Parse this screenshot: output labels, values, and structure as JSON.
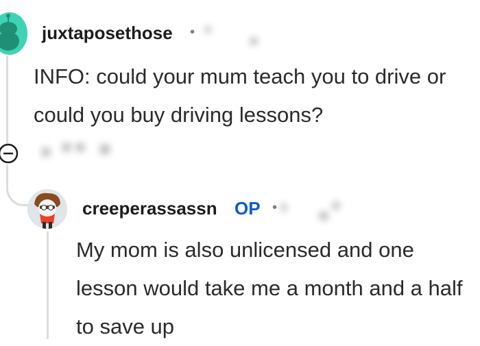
{
  "comments": [
    {
      "username": "juxtaposethose",
      "meta_separator": "•",
      "body": "INFO: could your mum teach you to drive or could you buy driving lessons?"
    },
    {
      "username": "creeperassassn",
      "badge": "OP",
      "meta_separator": "•",
      "body": "My mom is also unlicensed and one lesson would take me a month and a half to save up"
    }
  ],
  "colors": {
    "op_badge": "#0a5bd0",
    "avatar_1_bg": "#3fd3b6",
    "thread_line": "#dcdcdc"
  },
  "icons": {
    "collapse": "collapse-minus-icon"
  }
}
